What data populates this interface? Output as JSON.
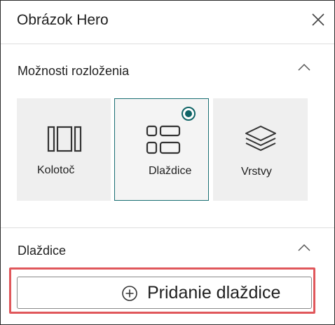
{
  "panel": {
    "title": "Obrázok Hero",
    "close_icon": "close-icon"
  },
  "layout_section": {
    "title": "Možnosti rozloženia",
    "tiles": [
      {
        "label": "Kolotoč",
        "icon": "carousel-icon",
        "selected": false
      },
      {
        "label": "Dlaždice",
        "icon": "tiles-icon",
        "selected": true
      },
      {
        "label": "Vrstvy",
        "icon": "layers-icon",
        "selected": false
      }
    ]
  },
  "tiles_section": {
    "title": "Dlaždice",
    "add_button_label": "Pridanie dlaždice",
    "add_icon": "add-circle-icon"
  },
  "colors": {
    "accent": "#0f6466",
    "highlight": "#e0575b",
    "tile_background": "#efefef"
  }
}
